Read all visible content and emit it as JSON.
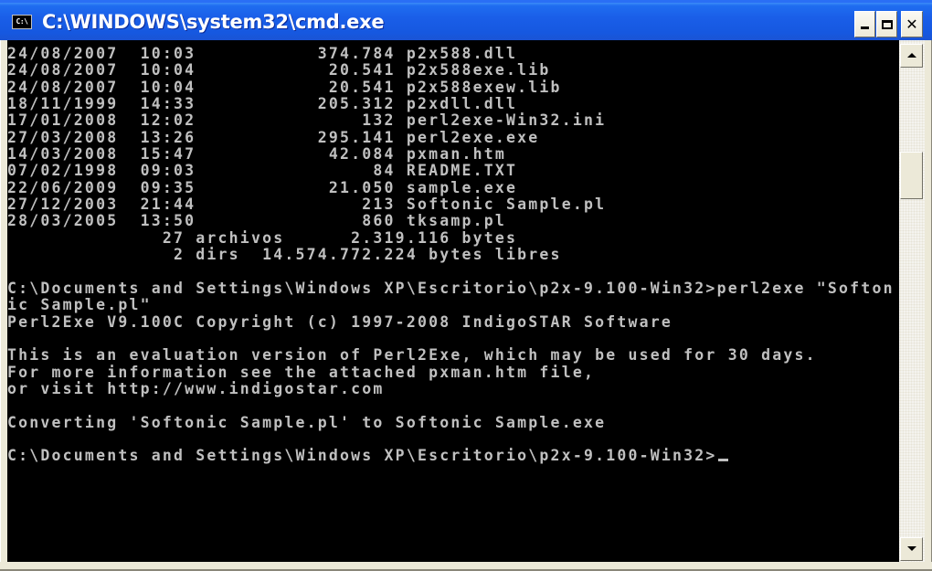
{
  "window": {
    "title": "C:\\WINDOWS\\system32\\cmd.exe",
    "icon_label": "C:\\",
    "icon": "cmd-icon",
    "buttons": {
      "minimize": "minimize-icon",
      "maximize": "maximize-icon",
      "close": "close-icon",
      "close_glyph": "✕"
    }
  },
  "console": {
    "lines": [
      "24/08/2007  10:03           374.784 p2x588.dll",
      "24/08/2007  10:04            20.541 p2x588exe.lib",
      "24/08/2007  10:04            20.541 p2x588exew.lib",
      "18/11/1999  14:33           205.312 p2xdll.dll",
      "17/01/2008  12:02               132 perl2exe-Win32.ini",
      "27/03/2008  13:26           295.141 perl2exe.exe",
      "14/03/2008  15:47            42.084 pxman.htm",
      "07/02/1998  09:03                84 README.TXT",
      "22/06/2009  09:35            21.050 sample.exe",
      "27/12/2003  21:44               213 Softonic Sample.pl",
      "28/03/2005  13:50               860 tksamp.pl",
      "              27 archivos      2.319.116 bytes",
      "               2 dirs  14.574.772.224 bytes libres",
      "",
      "C:\\Documents and Settings\\Windows XP\\Escritorio\\p2x-9.100-Win32>perl2exe \"Softon",
      "ic Sample.pl\"",
      "Perl2Exe V9.100C Copyright (c) 1997-2008 IndigoSTAR Software",
      "",
      "This is an evaluation version of Perl2Exe, which may be used for 30 days.",
      "For more information see the attached pxman.htm file,",
      "or visit http://www.indigostar.com",
      "",
      "Converting 'Softonic Sample.pl' to Softonic Sample.exe",
      "",
      "C:\\Documents and Settings\\Windows XP\\Escritorio\\p2x-9.100-Win32>"
    ],
    "text_color": "#c0c0c0",
    "background_color": "#000000"
  },
  "scrollbar": {
    "up_icon": "scroll-up-arrow-icon",
    "down_icon": "scroll-down-arrow-icon",
    "position_fraction": 0.2
  }
}
